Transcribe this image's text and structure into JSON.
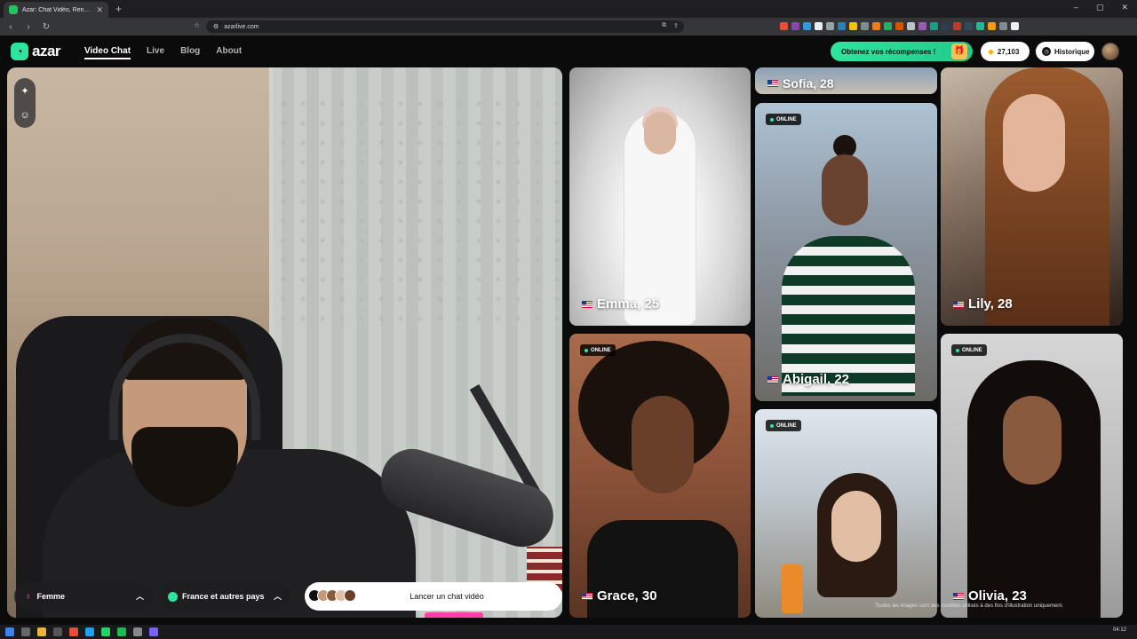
{
  "browser": {
    "tab_title": "Azar: Chat Vidéo, Rencontre",
    "tab_close": "✕",
    "new_tab": "+",
    "url": "azarlive.com",
    "window_controls": [
      "–",
      "▢",
      "✕"
    ]
  },
  "header": {
    "logo_text": "azar",
    "nav": [
      "Video Chat",
      "Live",
      "Blog",
      "About"
    ],
    "active_nav": "Video Chat",
    "rewards_label": "Obtenez vos récompenses !",
    "gems_count": "27,103",
    "history_label": "Historique"
  },
  "camera": {
    "tool_icons": [
      "sparkle-icon",
      "face-filter-icon"
    ]
  },
  "controls": {
    "gender_label": "Femme",
    "country_label": "France et autres pays",
    "start_label": "Lancer un chat vidéo"
  },
  "cards": {
    "sofia": {
      "name": "Sofia, 28"
    },
    "emma": {
      "name": "Emma, 25"
    },
    "abigail": {
      "name": "Abigail, 22",
      "status": "ONLINE"
    },
    "lily": {
      "name": "Lily, 28"
    },
    "grace": {
      "name": "Grace, 30",
      "status": "ONLINE"
    },
    "olivia": {
      "name": "Olivia, 23",
      "status": "ONLINE"
    },
    "new": {
      "status": "ONLINE"
    }
  },
  "disclaimer": "Toutes les images sont des modèles utilisés à des fins d'illustration uniquement.",
  "taskbar": {
    "time": "04:12"
  },
  "colors": {
    "accent": "#2ee59d",
    "pink": "#ff3fa8"
  }
}
